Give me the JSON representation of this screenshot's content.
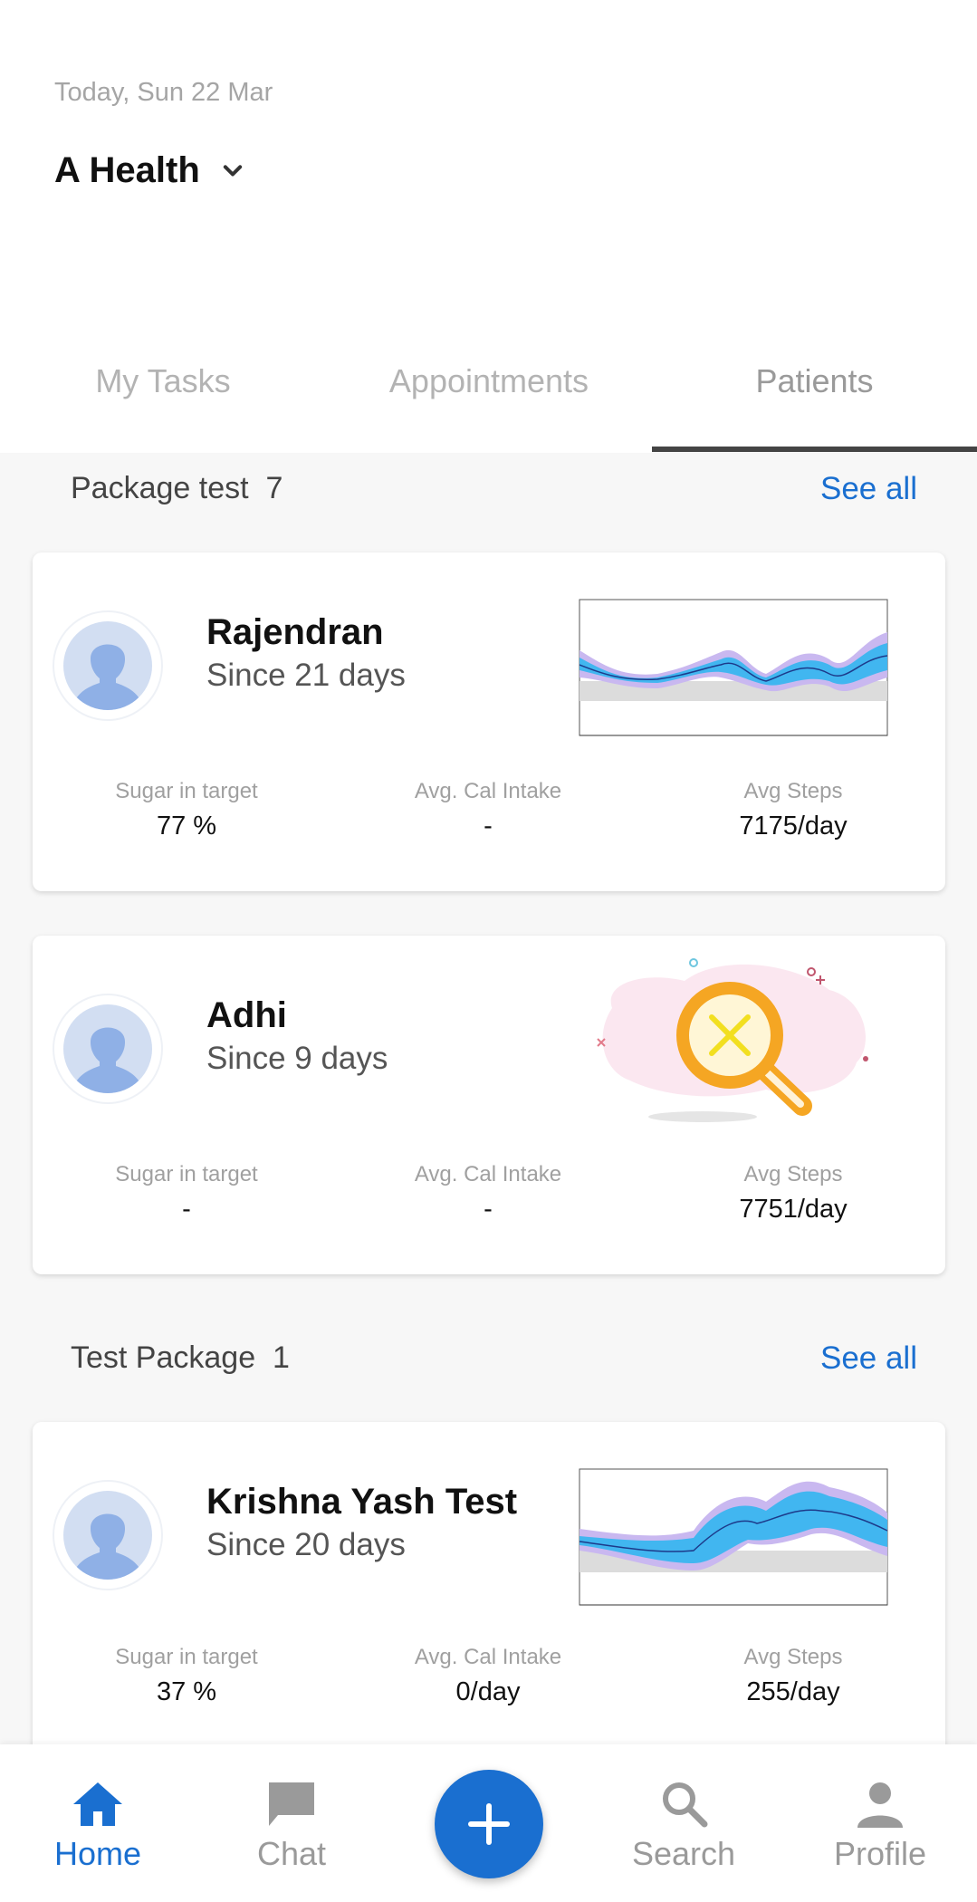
{
  "header": {
    "date": "Today, Sun 22 Mar",
    "org_name": "A Health"
  },
  "tabs": [
    {
      "label": "My Tasks"
    },
    {
      "label": "Appointments"
    },
    {
      "label": "Patients",
      "active": true
    }
  ],
  "groups": [
    {
      "title": "Package test",
      "count": "7",
      "see_all": "See all",
      "patients": [
        {
          "name": "Rajendran",
          "since": "Since 21 days",
          "graph": "agp-chart",
          "stats": [
            {
              "label": "Sugar in target",
              "value": "77 %"
            },
            {
              "label": "Avg. Cal Intake",
              "value": "-"
            },
            {
              "label": "Avg Steps",
              "value": "7175/day"
            }
          ]
        },
        {
          "name": "Adhi",
          "since": "Since 9 days",
          "graph": "no-data-illustration",
          "stats": [
            {
              "label": "Sugar in target",
              "value": "-"
            },
            {
              "label": "Avg. Cal Intake",
              "value": "-"
            },
            {
              "label": "Avg Steps",
              "value": "7751/day"
            }
          ]
        }
      ]
    },
    {
      "title": "Test Package",
      "count": "1",
      "see_all": "See all",
      "patients": [
        {
          "name": "Krishna Yash Test",
          "since": "Since 20 days",
          "graph": "agp-chart",
          "stats": [
            {
              "label": "Sugar in target",
              "value": "37 %"
            },
            {
              "label": "Avg. Cal Intake",
              "value": "0/day"
            },
            {
              "label": "Avg Steps",
              "value": "255/day"
            }
          ]
        }
      ]
    }
  ],
  "bottom_nav": [
    {
      "label": "Home",
      "icon": "home-icon",
      "active": true
    },
    {
      "label": "Chat",
      "icon": "chat-icon"
    },
    {
      "label": "Search",
      "icon": "search-icon"
    },
    {
      "label": "Profile",
      "icon": "profile-icon"
    }
  ],
  "fab": {
    "icon": "plus-icon"
  },
  "colors": {
    "accent": "#1a6fd0",
    "tab_indicator": "#444444",
    "background": "#f7f7f7"
  }
}
